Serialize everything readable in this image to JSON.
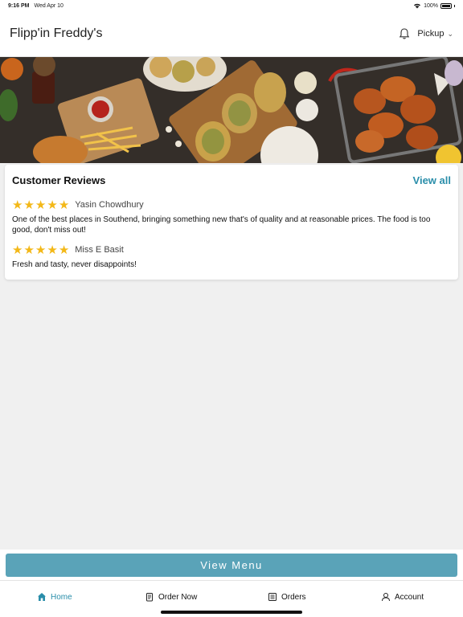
{
  "status_bar": {
    "time": "9:16 PM",
    "date": "Wed Apr 10",
    "battery": "100%"
  },
  "header": {
    "title": "Flipp'in Freddy's",
    "mode": "Pickup"
  },
  "reviews": {
    "title": "Customer Reviews",
    "view_all": "View all",
    "items": [
      {
        "rating": 5,
        "name": "Yasin Chowdhury",
        "text": "One of the best places in Southend, bringing something new that's of quality and at reasonable prices. The food is too good, don't miss out!"
      },
      {
        "rating": 5,
        "name": "Miss E Basit",
        "text": "Fresh and tasty, never disappoints!"
      }
    ]
  },
  "view_menu_label": "View Menu",
  "tabs": [
    {
      "label": "Home",
      "icon": "home-icon",
      "active": true
    },
    {
      "label": "Order Now",
      "icon": "order-icon",
      "active": false
    },
    {
      "label": "Orders",
      "icon": "receipt-icon",
      "active": false
    },
    {
      "label": "Account",
      "icon": "person-icon",
      "active": false
    }
  ],
  "colors": {
    "accent": "#2a8eaa",
    "button": "#5aa3b8",
    "star": "#f3b818"
  }
}
